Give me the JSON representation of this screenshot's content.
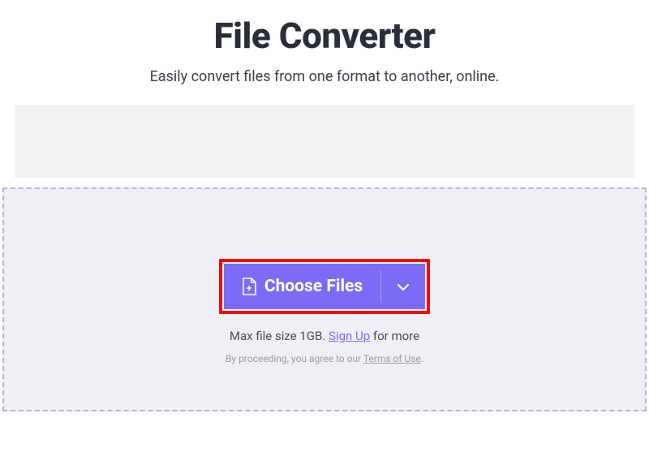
{
  "header": {
    "title": "File Converter",
    "subtitle": "Easily convert files from one format to another, online."
  },
  "dropzone": {
    "choose_label": "Choose Files",
    "max_size_prefix": "Max file size 1GB. ",
    "signup_label": "Sign Up",
    "max_size_suffix": " for more",
    "terms_prefix": "By proceeding, you agree to our ",
    "terms_link": "Terms of Use",
    "terms_suffix": "."
  },
  "colors": {
    "accent": "#7b6cf6",
    "highlight_border": "#ff0000"
  }
}
